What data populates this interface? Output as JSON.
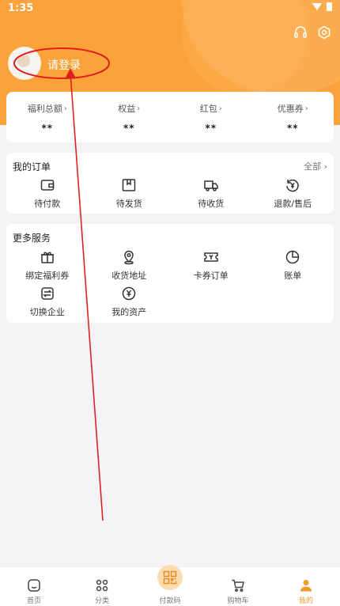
{
  "status": {
    "time": "1:35"
  },
  "header": {
    "login_prompt": "请登录"
  },
  "stats": [
    {
      "label": "福利总额",
      "value": "**"
    },
    {
      "label": "权益",
      "value": "**"
    },
    {
      "label": "红包",
      "value": "**"
    },
    {
      "label": "优惠券",
      "value": "**"
    }
  ],
  "orders": {
    "title": "我的订单",
    "more": "全部",
    "items": [
      {
        "label": "待付款",
        "icon": "wallet-icon"
      },
      {
        "label": "待发货",
        "icon": "package-icon"
      },
      {
        "label": "待收货",
        "icon": "truck-icon"
      },
      {
        "label": "退款/售后",
        "icon": "refund-icon"
      }
    ]
  },
  "services": {
    "title": "更多服务",
    "items": [
      {
        "label": "绑定福利券",
        "icon": "gift-icon"
      },
      {
        "label": "收货地址",
        "icon": "location-icon"
      },
      {
        "label": "卡券订单",
        "icon": "ticket-icon"
      },
      {
        "label": "账单",
        "icon": "pie-chart-icon"
      },
      {
        "label": "切换企业",
        "icon": "switch-icon"
      },
      {
        "label": "我的资产",
        "icon": "yen-circle-icon"
      }
    ]
  },
  "nav": [
    {
      "label": "首页",
      "icon": "home-icon"
    },
    {
      "label": "分类",
      "icon": "grid-icon"
    },
    {
      "label": "付款码",
      "icon": "qr-code-icon"
    },
    {
      "label": "购物车",
      "icon": "cart-icon"
    },
    {
      "label": "我的",
      "icon": "person-icon"
    }
  ],
  "colors": {
    "accent": "#fba33a",
    "annotation": "#e02020",
    "active_nav": "#f39a2b"
  }
}
